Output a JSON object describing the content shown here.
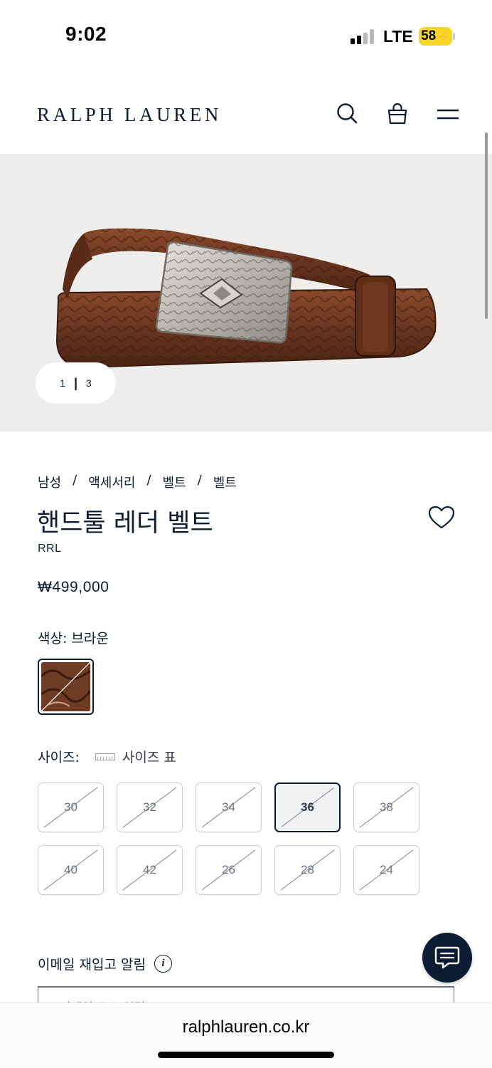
{
  "status_bar": {
    "time": "9:02",
    "network": "LTE",
    "battery": "58",
    "signal_bars": 2
  },
  "header": {
    "logo": "RALPH LAUREN",
    "icons": [
      "search-icon",
      "shopping-bag-icon",
      "menu-icon"
    ]
  },
  "gallery": {
    "current": "1",
    "separator": "|",
    "total": "3"
  },
  "breadcrumb": [
    "남성",
    "액세서리",
    "벨트",
    "벨트"
  ],
  "breadcrumb_separator": "/",
  "product": {
    "title": "핸드툴 레더 벨트",
    "brand": "RRL",
    "price": "₩499,000",
    "color_label": "색상:",
    "color_value": "브라운"
  },
  "size": {
    "label": "사이즈:",
    "guide_label": "사이즈 표",
    "options": [
      "30",
      "32",
      "34",
      "36",
      "38",
      "40",
      "42",
      "26",
      "28",
      "24"
    ],
    "selected": "36",
    "all_unavailable": true
  },
  "restock": {
    "label": "이메일 재입고 알림",
    "email_placeholder": "이메일 주소 입력"
  },
  "browser": {
    "url": "ralphlauren.co.kr"
  },
  "colors": {
    "navy": "#0c1c33",
    "hero_bg": "#efeeec",
    "battery": "#f6d629",
    "leather": "#6e3b24"
  }
}
